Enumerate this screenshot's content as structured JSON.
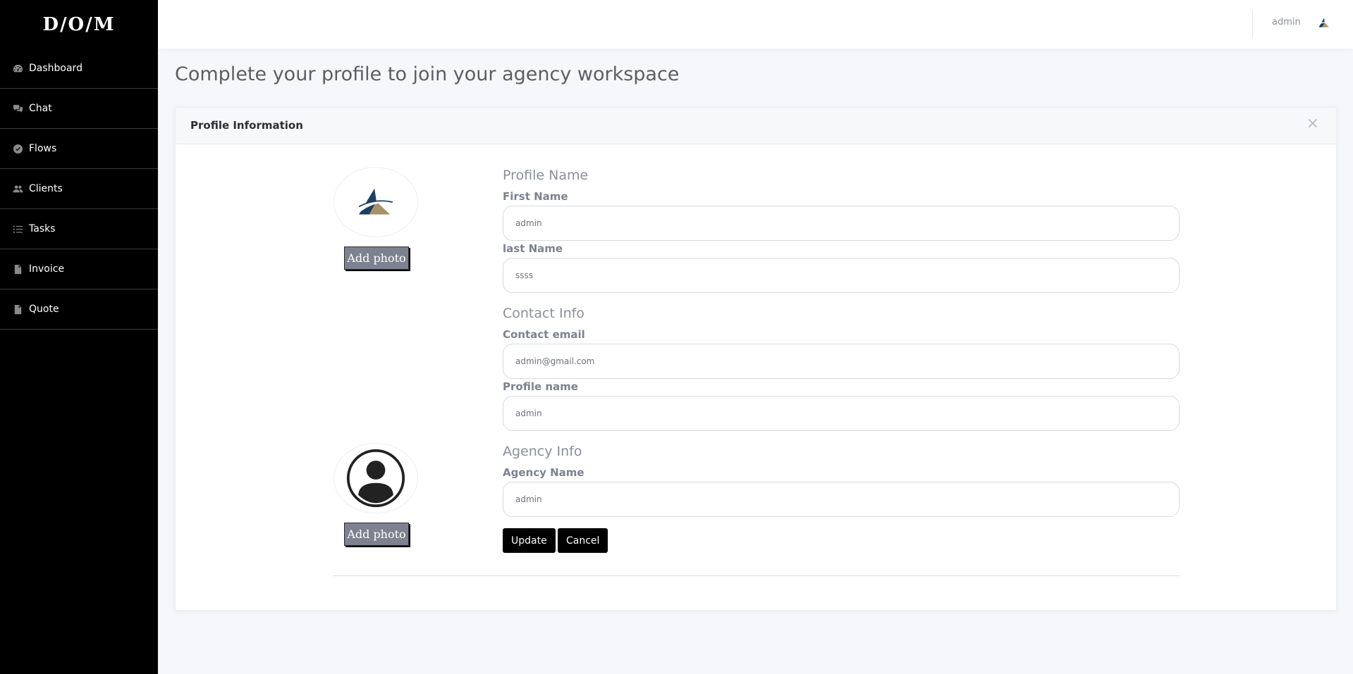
{
  "app": {
    "logo_text": "D/O/M"
  },
  "sidebar": {
    "items": [
      {
        "label": "Dashboard",
        "icon": "gauge-icon"
      },
      {
        "label": "Chat",
        "icon": "chat-bubbles-icon"
      },
      {
        "label": "Flows",
        "icon": "check-circle-icon"
      },
      {
        "label": "Clients",
        "icon": "users-icon"
      },
      {
        "label": "Tasks",
        "icon": "list-icon"
      },
      {
        "label": "Invoice",
        "icon": "file-text-icon"
      },
      {
        "label": "Quote",
        "icon": "file-icon"
      }
    ]
  },
  "topbar": {
    "username": "admin",
    "avatar_icon": "agency-logo-icon"
  },
  "page": {
    "title": "Complete your profile to join your agency workspace"
  },
  "card": {
    "title": "Profile Information",
    "close_label": "×",
    "profile_photo": {
      "add_label": "Add photo",
      "icon": "agency-logo-icon"
    },
    "agency_photo": {
      "add_label": "Add photo",
      "icon": "user-avatar-icon"
    },
    "sections": {
      "profile_name": "Profile Name",
      "contact_info": "Contact Info",
      "agency_info": "Agency Info"
    },
    "fields": {
      "first_name": {
        "label": "First Name",
        "value": "admin"
      },
      "last_name": {
        "label": "last Name",
        "value": "ssss"
      },
      "contact_email": {
        "label": "Contact email",
        "value": "admin@gmail.com"
      },
      "profile_name": {
        "label": "Profile name",
        "value": "admin"
      },
      "agency_name": {
        "label": "Agency Name",
        "value": "admin"
      }
    },
    "buttons": {
      "update": "Update",
      "cancel": "Cancel"
    }
  },
  "colors": {
    "sidebar_bg": "#000000",
    "button_bg": "#000000",
    "add_photo_bg": "#7d8190",
    "logo_navy": "#1c3f63",
    "logo_gold": "#a8906a"
  }
}
